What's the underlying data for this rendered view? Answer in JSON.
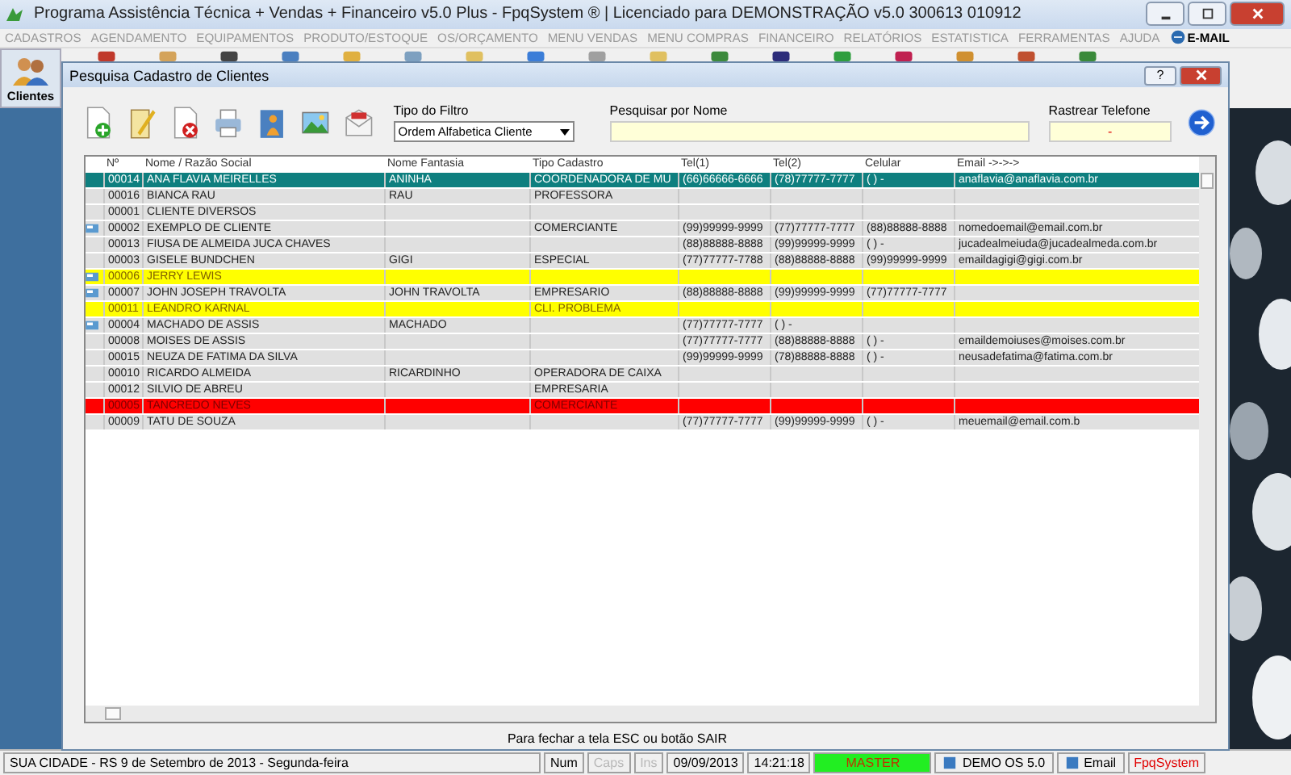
{
  "window": {
    "title": "Programa Assistência Técnica + Vendas + Financeiro v5.0 Plus - FpqSystem ® | Licenciado para  DEMONSTRAÇÃO v5.0 300613 010912"
  },
  "menu": [
    "CADASTROS",
    "AGENDAMENTO",
    "EQUIPAMENTOS",
    "PRODUTO/ESTOQUE",
    "OS/ORÇAMENTO",
    "MENU VENDAS",
    "MENU COMPRAS",
    "FINANCEIRO",
    "RELATÓRIOS",
    "ESTATISTICA",
    "FERRAMENTAS",
    "AJUDA"
  ],
  "email_menu": "E-MAIL",
  "toolbar": {
    "clientes": "Clientes"
  },
  "dialog": {
    "title": "Pesquisa Cadastro de Clientes",
    "help": "?",
    "filter": {
      "label": "Tipo do Filtro",
      "value": "Ordem Alfabetica Cliente"
    },
    "search": {
      "label": "Pesquisar por Nome"
    },
    "phone": {
      "label": "Rastrear Telefone",
      "value": "-"
    },
    "columns": [
      "Nº",
      "Nome / Razão Social",
      "Nome Fantasia",
      "Tipo Cadastro",
      "Tel(1)",
      "Tel(2)",
      "Celular",
      "Email ->->->"
    ],
    "rows": [
      {
        "selected": true,
        "flag": false,
        "cells": [
          "00014",
          "ANA FLAVIA MEIRELLES",
          "ANINHA",
          "COORDENADORA DE MU",
          "(66)66666-6666",
          "(78)77777-7777",
          "(  )    -",
          "anaflavia@anaflavia.com.br"
        ]
      },
      {
        "selected": false,
        "flag": false,
        "cells": [
          "00016",
          "BIANCA RAU",
          "RAU",
          "PROFESSORA"
        ]
      },
      {
        "selected": false,
        "flag": false,
        "cells": [
          "00001",
          "CLIENTE DIVERSOS"
        ]
      },
      {
        "selected": false,
        "flag": true,
        "cells": [
          "00002",
          "EXEMPLO DE CLIENTE",
          "",
          "COMERCIANTE",
          "(99)99999-9999",
          "(77)77777-7777",
          "(88)88888-8888",
          "nomedoemail@email.com.br"
        ]
      },
      {
        "selected": false,
        "flag": false,
        "cells": [
          "00013",
          "FIUSA DE ALMEIDA JUCA CHAVES",
          "",
          "",
          "(88)88888-8888",
          "(99)99999-9999",
          "(  )    -",
          "jucadealmeiuda@jucadealmeda.com.br"
        ]
      },
      {
        "selected": false,
        "flag": false,
        "cells": [
          "00003",
          "GISELE BUNDCHEN",
          "GIGI",
          "ESPECIAL",
          "(77)77777-7788",
          "(88)88888-8888",
          "(99)99999-9999",
          "emaildagigi@gigi.com.br"
        ]
      },
      {
        "selected": false,
        "flag": true,
        "color": "#ffff00",
        "cells": [
          "00006",
          "JERRY LEWIS"
        ]
      },
      {
        "selected": false,
        "flag": true,
        "cells": [
          "00007",
          "JOHN JOSEPH TRAVOLTA",
          "JOHN TRAVOLTA",
          "EMPRESARIO",
          "(88)88888-8888",
          "(99)99999-9999",
          "(77)77777-7777"
        ]
      },
      {
        "selected": false,
        "flag": false,
        "color": "#ffff00",
        "cells": [
          "00011",
          "LEANDRO KARNAL",
          "",
          "CLI. PROBLEMA"
        ]
      },
      {
        "selected": false,
        "flag": true,
        "cells": [
          "00004",
          "MACHADO DE ASSIS",
          "MACHADO",
          "",
          "(77)77777-7777",
          "(  )    -"
        ]
      },
      {
        "selected": false,
        "flag": false,
        "cells": [
          "00008",
          "MOISES DE ASSIS",
          "",
          "",
          "(77)77777-7777",
          "(88)88888-8888",
          "(  )    -",
          "emaildemoiuses@moises.com.br"
        ]
      },
      {
        "selected": false,
        "flag": false,
        "cells": [
          "00015",
          "NEUZA DE FATIMA DA SILVA",
          "",
          "",
          "(99)99999-9999",
          "(78)88888-8888",
          "(  )    -",
          "neusadefatima@fatima.com.br"
        ]
      },
      {
        "selected": false,
        "flag": false,
        "cells": [
          "00010",
          "RICARDO ALMEIDA",
          "RICARDINHO",
          "OPERADORA DE CAIXA"
        ]
      },
      {
        "selected": false,
        "flag": false,
        "cells": [
          "00012",
          "SILVIO DE ABREU",
          "",
          "EMPRESARIA"
        ]
      },
      {
        "selected": false,
        "flag": false,
        "color": "#ff0000",
        "cells": [
          "00005",
          "TANCREDO NEVES",
          "",
          "COMERCIANTE"
        ]
      },
      {
        "selected": false,
        "flag": false,
        "cells": [
          "00009",
          "TATU DE SOUZA",
          "",
          "",
          "(77)77777-7777",
          "(99)99999-9999",
          "(  )    -",
          "meuemail@email.com.b"
        ]
      }
    ],
    "footer": "Para fechar a tela ESC ou botão SAIR"
  },
  "status_bar": [
    {
      "kind": "text",
      "text": "SUA CIDADE - RS  9 de Setembro de 2013 - Segunda-feira"
    },
    {
      "kind": "key",
      "text": "Num",
      "disabled": false
    },
    {
      "kind": "key",
      "text": "Caps",
      "disabled": true
    },
    {
      "kind": "key",
      "text": "Ins",
      "disabled": true
    },
    {
      "kind": "text",
      "text": "09/09/2013"
    },
    {
      "kind": "text",
      "text": "14:21:18"
    },
    {
      "kind": "user",
      "text": "MASTER"
    },
    {
      "kind": "icontext",
      "text": "DEMO OS 5.0"
    },
    {
      "kind": "icontext",
      "text": "Email"
    },
    {
      "kind": "brand",
      "text": "FpqSystem"
    }
  ]
}
